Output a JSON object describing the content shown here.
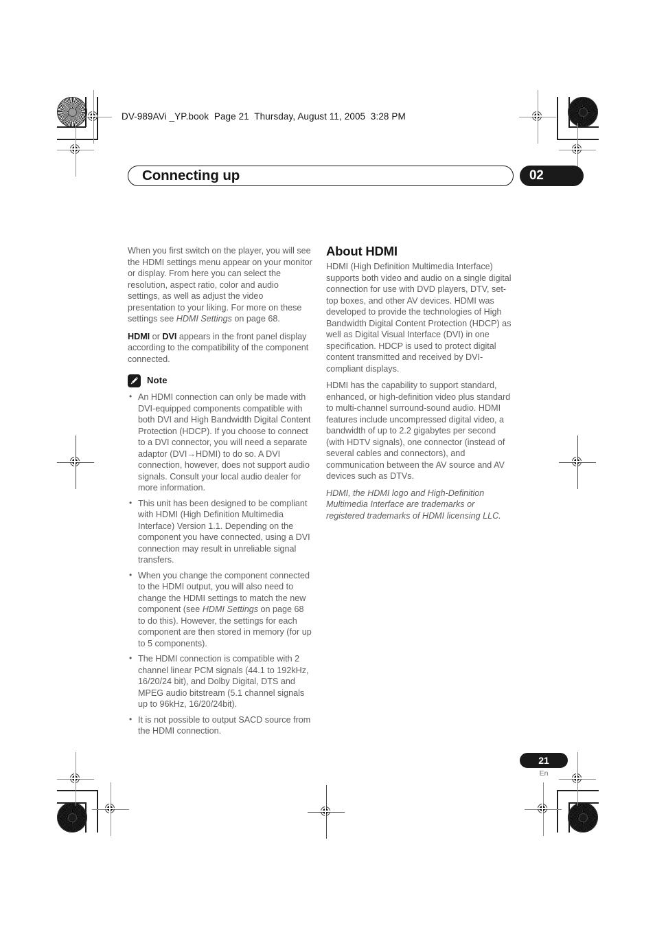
{
  "print_header": "DV-989AVi _YP.book  Page 21  Thursday, August 11, 2005  3:28 PM",
  "chapter": {
    "title": "Connecting up",
    "number": "02"
  },
  "left_column": {
    "intro_paragraph": {
      "part1": "When you first switch on the player, you will see the HDMI settings menu appear on your monitor or display. From here you can select the resolution, aspect ratio, color and audio settings, as well as adjust the video presentation to your liking. For more on these settings see ",
      "italic_ref": "HDMI Settings",
      "part2": " on page 68."
    },
    "display_paragraph": {
      "bold1": "HDMI",
      "mid": " or ",
      "bold2": "DVI",
      "rest": " appears in the front panel display according to the compatibility of the component connected."
    },
    "note": {
      "icon": "pencil-icon",
      "label": "Note",
      "bullets": [
        "An HDMI connection can only be made with DVI-equipped components compatible with both DVI and High Bandwidth Digital Content Protection (HDCP). If you choose to connect to a DVI connector, you will need a separate adaptor (DVI→HDMI) to do so. A DVI connection, however, does not support audio signals. Consult your local audio dealer for more information.",
        "This unit has been designed to be compliant with HDMI (High Definition Multimedia Interface) Version 1.1. Depending on the component you have connected, using a DVI connection may result in unreliable signal transfers.",
        "The HDMI connection is compatible with 2 channel linear PCM signals (44.1 to 192kHz, 16/20/24 bit), and Dolby Digital, DTS and MPEG audio bitstream (5.1 channel signals up to 96kHz, 16/20/24bit).",
        "It is not possible to output SACD source from the HDMI connection."
      ],
      "bullet_with_italic": {
        "part1": "When you change the component connected to the HDMI output, you will also need to change the HDMI settings to match the new component (see ",
        "italic_ref": "HDMI Settings",
        "part2": " on page 68 to do this). However, the settings for each component are then stored in memory (for up to 5 components)."
      }
    }
  },
  "right_column": {
    "heading": "About HDMI",
    "paragraph1": "HDMI (High Definition Multimedia Interface) supports both video and audio on a single digital connection for use with DVD players, DTV, set-top boxes, and other AV devices. HDMI was developed to provide the technologies of High Bandwidth Digital Content Protection (HDCP) as well as Digital Visual Interface (DVI) in one specification. HDCP is used to protect digital content transmitted and received by DVI-compliant displays.",
    "paragraph2": "HDMI has the capability to support standard, enhanced, or high-definition video plus standard to multi-channel surround-sound audio. HDMI features include uncompressed digital video, a bandwidth of up to 2.2 gigabytes per second (with HDTV signals), one connector (instead of several cables and connectors), and communication between the AV source and AV devices such as DTVs.",
    "trademark_notice": "HDMI, the HDMI logo and High-Definition Multimedia Interface are trademarks or registered trademarks of HDMI licensing LLC."
  },
  "footer": {
    "page_number": "21",
    "language_code": "En"
  },
  "colors": {
    "body_text": "#5b5b5b",
    "heading_text": "#141414",
    "badge_background": "#1a1a1a",
    "badge_text": "#ffffff"
  }
}
